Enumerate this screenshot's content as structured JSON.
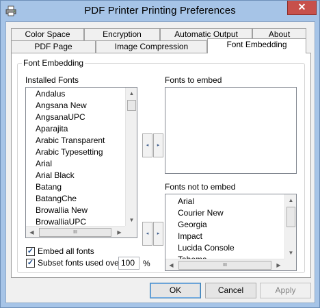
{
  "window": {
    "title": "PDF Printer Printing Preferences",
    "close_label": "✕"
  },
  "tabs": {
    "row1": [
      "Color Space",
      "Encryption",
      "Automatic Output",
      "About"
    ],
    "row2": [
      "PDF Page",
      "Image Compression",
      "Font Embedding"
    ],
    "active": "Font Embedding"
  },
  "group": {
    "label": "Font Embedding"
  },
  "installed": {
    "label": "Installed Fonts",
    "items": [
      "Andalus",
      "Angsana New",
      "AngsanaUPC",
      "Aparajita",
      "Arabic Transparent",
      "Arabic Typesetting",
      "Arial",
      "Arial Black",
      "Batang",
      "BatangChe",
      "Browallia New",
      "BrowalliaUPC"
    ]
  },
  "to_embed": {
    "label": "Fonts to embed",
    "items": []
  },
  "not_embed": {
    "label": "Fonts not to embed",
    "items": [
      "Arial",
      "Courier New",
      "Georgia",
      "Impact",
      "Lucida Console",
      "Tahoma"
    ]
  },
  "options": {
    "embed_all": {
      "label": "Embed all fonts",
      "checked": true
    },
    "subset": {
      "label": "Subset fonts used over",
      "checked": true,
      "value": "100",
      "unit": "%"
    }
  },
  "buttons": {
    "ok": "OK",
    "cancel": "Cancel",
    "apply": "Apply"
  },
  "icons": {
    "scroll_up": "▲",
    "scroll_down": "▼",
    "scroll_left": "◀",
    "scroll_right": "▶",
    "move_left": "◂",
    "move_right": "▸",
    "grip": "III",
    "check": "✓"
  }
}
